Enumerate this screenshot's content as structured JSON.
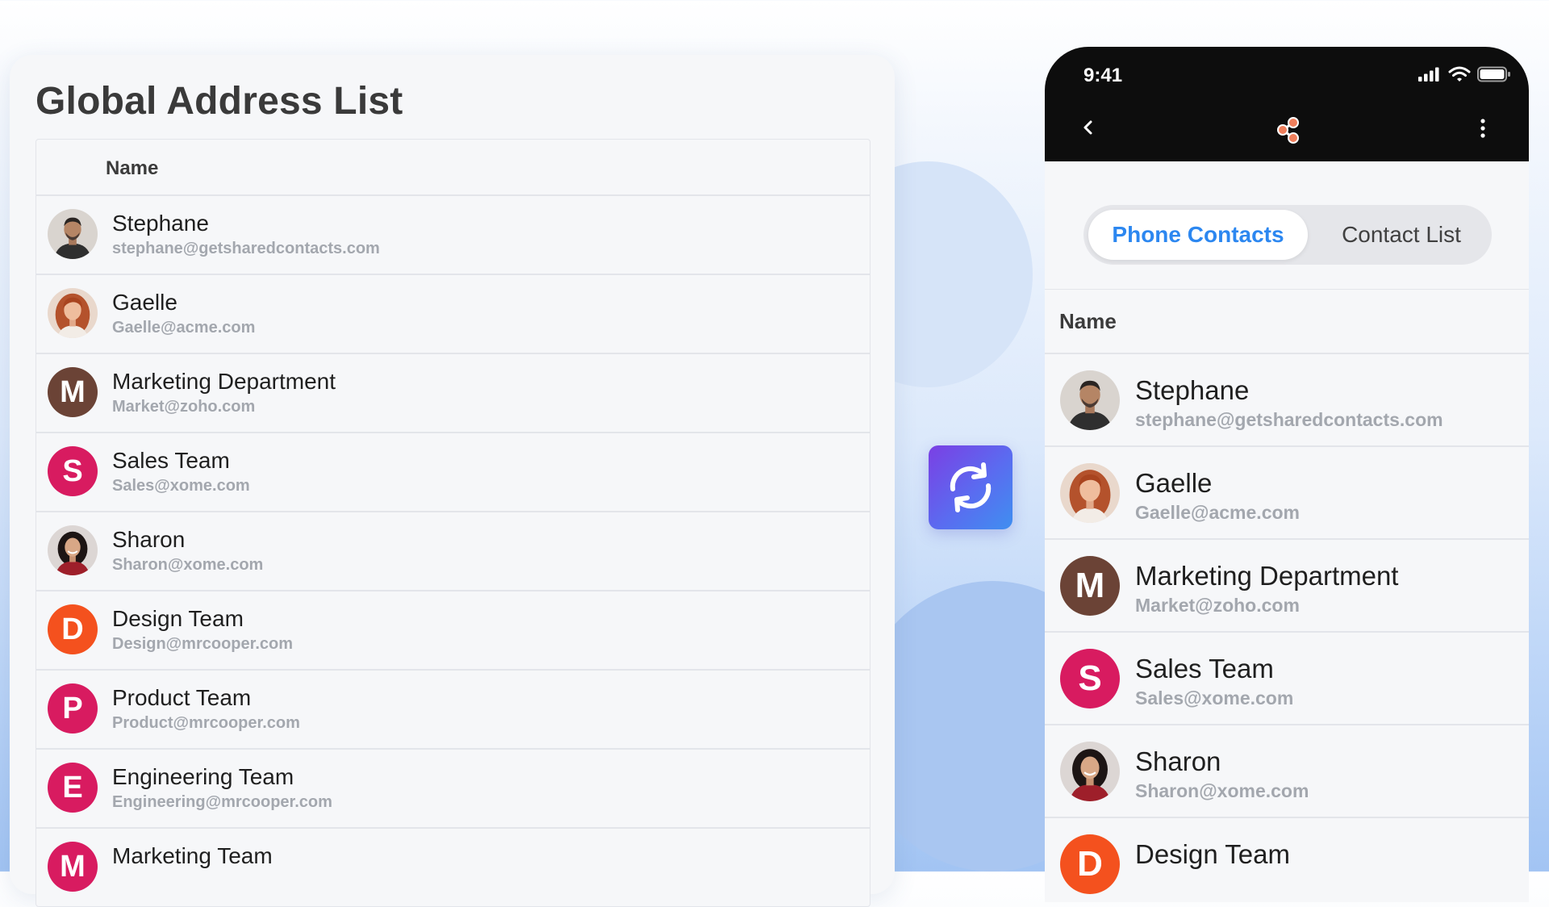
{
  "gal": {
    "title": "Global Address List",
    "column_header": "Name",
    "rows": [
      {
        "name": "Stephane",
        "email": "stephane@getsharedcontacts.com",
        "avatar": "photo-man"
      },
      {
        "name": "Gaelle",
        "email": "Gaelle@acme.com",
        "avatar": "photo-woman-red"
      },
      {
        "name": "Marketing Department",
        "email": "Market@zoho.com",
        "letter": "M",
        "color": "#6b4336"
      },
      {
        "name": "Sales Team",
        "email": "Sales@xome.com",
        "letter": "S",
        "color": "#d81b60"
      },
      {
        "name": "Sharon",
        "email": "Sharon@xome.com",
        "avatar": "photo-woman-dark"
      },
      {
        "name": "Design Team",
        "email": "Design@mrcooper.com",
        "letter": "D",
        "color": "#f4511e"
      },
      {
        "name": "Product Team",
        "email": "Product@mrcooper.com",
        "letter": "P",
        "color": "#d81b60"
      },
      {
        "name": "Engineering Team",
        "email": "Engineering@mrcooper.com",
        "letter": "E",
        "color": "#d81b60"
      },
      {
        "name": "Marketing Team",
        "email": "",
        "letter": "M",
        "color": "#d81b60"
      }
    ]
  },
  "sync": {
    "icon": "sync-icon",
    "color_start": "#7b3fe4",
    "color_end": "#3f8ff0"
  },
  "phone": {
    "status_time": "9:41",
    "tabs": [
      {
        "label": "Phone Contacts",
        "active": true,
        "color": "#2c87f0"
      },
      {
        "label": "Contact List",
        "active": false
      }
    ],
    "column_header": "Name",
    "rows": [
      {
        "name": "Stephane",
        "email": "stephane@getsharedcontacts.com",
        "avatar": "photo-man"
      },
      {
        "name": "Gaelle",
        "email": "Gaelle@acme.com",
        "avatar": "photo-woman-red"
      },
      {
        "name": "Marketing Department",
        "email": "Market@zoho.com",
        "letter": "M",
        "color": "#6b4336"
      },
      {
        "name": "Sales Team",
        "email": "Sales@xome.com",
        "letter": "S",
        "color": "#d81b60"
      },
      {
        "name": "Sharon",
        "email": "Sharon@xome.com",
        "avatar": "photo-woman-dark"
      },
      {
        "name": "Design Team",
        "email": "",
        "letter": "D",
        "color": "#f4511e"
      }
    ]
  }
}
